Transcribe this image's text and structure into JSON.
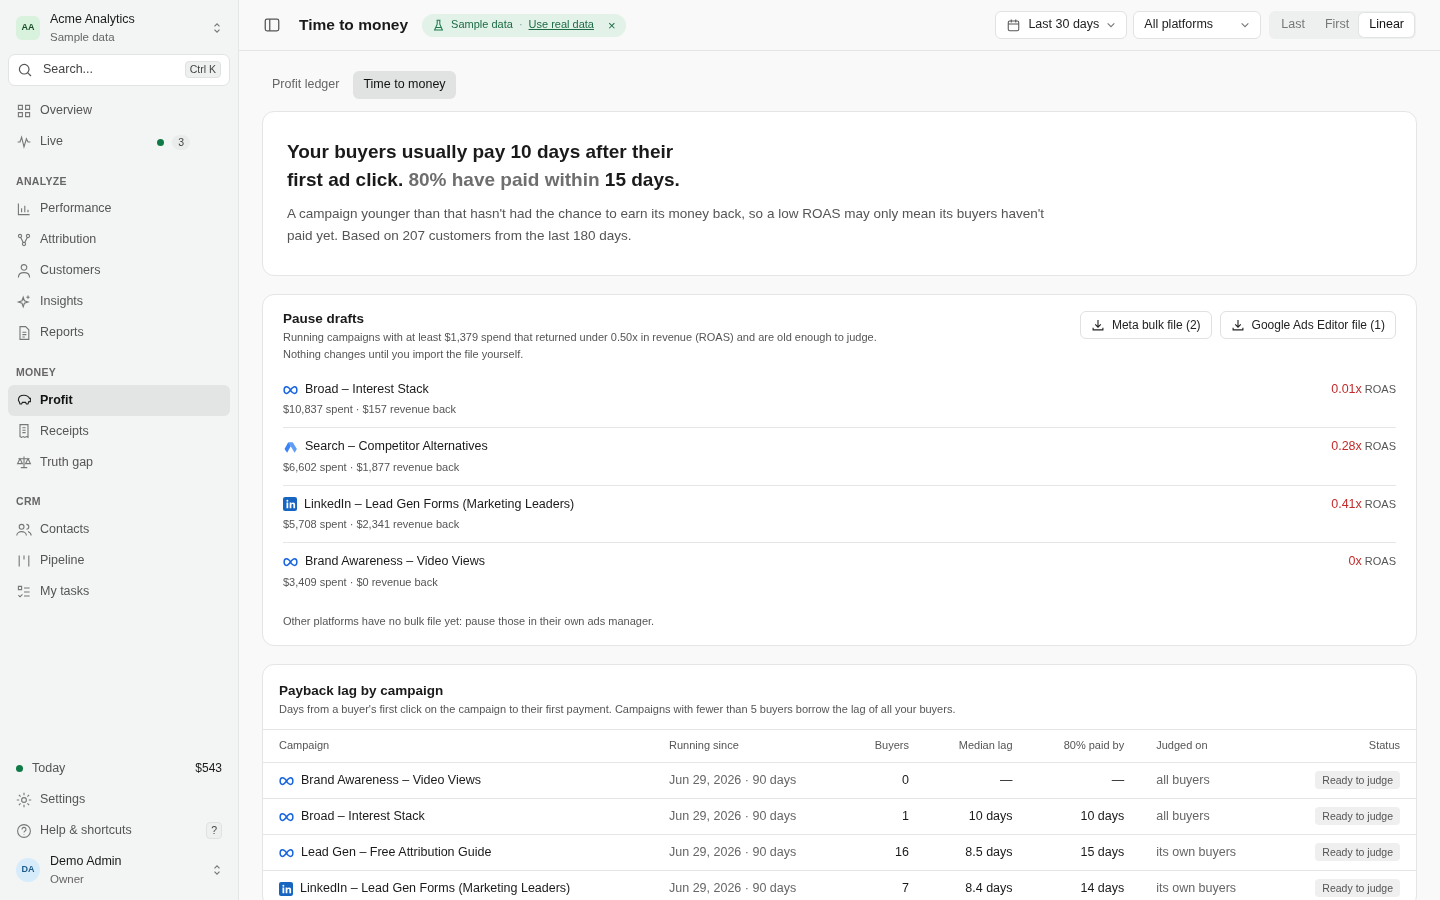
{
  "workspace": {
    "avatar": "AA",
    "name": "Acme Analytics",
    "subtitle": "Sample data"
  },
  "search": {
    "placeholder": "Search...",
    "shortcut": "Ctrl K"
  },
  "nav_top": [
    {
      "label": "Overview",
      "selected": false
    },
    {
      "label": "Live",
      "selected": false,
      "badge": "3"
    }
  ],
  "nav_sections": [
    {
      "title": "ANALYZE",
      "items": [
        {
          "label": "Performance",
          "selected": false
        },
        {
          "label": "Attribution",
          "selected": false
        },
        {
          "label": "Customers",
          "selected": false
        },
        {
          "label": "Insights",
          "selected": false
        },
        {
          "label": "Reports",
          "selected": false
        }
      ]
    },
    {
      "title": "MONEY",
      "items": [
        {
          "label": "Profit",
          "selected": true
        },
        {
          "label": "Receipts",
          "selected": false
        },
        {
          "label": "Truth gap",
          "selected": false
        }
      ]
    },
    {
      "title": "CRM",
      "items": [
        {
          "label": "Contacts",
          "selected": false
        },
        {
          "label": "Pipeline",
          "selected": false
        },
        {
          "label": "My tasks",
          "selected": false
        }
      ]
    }
  ],
  "today": {
    "label": "Today",
    "value": "$543"
  },
  "footer_links": [
    {
      "label": "Settings"
    },
    {
      "label": "Help & shortcuts",
      "shortcut": "?"
    }
  ],
  "user": {
    "avatar": "DA",
    "name": "Demo Admin",
    "role": "Owner"
  },
  "header": {
    "title": "Time to money",
    "banner": {
      "label": "Sample data",
      "separator": "·",
      "link": "Use real data",
      "close": "×"
    },
    "date_range": "Last 30 days",
    "platform": "All platforms",
    "models": [
      {
        "label": "Last",
        "selected": false
      },
      {
        "label": "First",
        "selected": false
      },
      {
        "label": "Linear",
        "selected": true
      }
    ]
  },
  "tabs": [
    {
      "label": "Profit ledger",
      "selected": false
    },
    {
      "label": "Time to money",
      "selected": true
    }
  ],
  "summary": {
    "headline": [
      [
        {
          "text": "Your buyers usually pay 10 days after their",
          "muted": false
        }
      ],
      [
        {
          "text": "first ad click.",
          "muted": false
        },
        {
          "text": "80% have paid within",
          "muted": true
        },
        {
          "text": "15 days.",
          "muted": false
        }
      ]
    ],
    "body": "A campaign younger than that hasn't had the chance to earn its money back, so a low ROAS may only mean its buyers haven't paid yet. Based on 207 customers from the last 180 days."
  },
  "pause_drafts": {
    "title": "Pause drafts",
    "description": "Running campaigns with at least $1,379 spend that returned under 0.50x in revenue (ROAS) and are old enough to judge.",
    "note": "Nothing changes until you import the file yourself.",
    "buttons": [
      "Meta bulk file (2)",
      "Google Ads Editor file (1)"
    ],
    "items": [
      {
        "kind": "meta",
        "name": "Broad – Interest Stack",
        "detail": "$10,837 spent · $157 revenue back",
        "roas": "0.01x",
        "roas_unit": "ROAS"
      },
      {
        "kind": "google",
        "name": "Search – Competitor Alternatives",
        "detail": "$6,602 spent · $1,877 revenue back",
        "roas": "0.28x",
        "roas_unit": "ROAS"
      },
      {
        "kind": "linkedin",
        "name": "LinkedIn – Lead Gen Forms (Marketing Leaders)",
        "detail": "$5,708 spent · $2,341 revenue back",
        "roas": "0.41x",
        "roas_unit": "ROAS"
      },
      {
        "kind": "meta",
        "name": "Brand Awareness – Video Views",
        "detail": "$3,409 spent · $0 revenue back",
        "roas": "0x",
        "roas_unit": "ROAS"
      }
    ],
    "footer": "Other platforms have no bulk file yet: pause those in their own ads manager."
  },
  "payback": {
    "title": "Payback lag by campaign",
    "description": "Days from a buyer's first click on the campaign to their first payment. Campaigns with fewer than 5 buyers borrow the lag of all your buyers.",
    "columns": [
      "Campaign",
      "Running since",
      "Buyers",
      "Median lag",
      "80% paid by",
      "Judged on",
      "Status"
    ],
    "rows": [
      {
        "kind": "meta",
        "campaign": "Brand Awareness – Video Views",
        "running_since": "Jun 29, 2026 · 90 days",
        "buyers": "0",
        "median_lag": "—",
        "paid_80": "—",
        "judged_on": "all buyers",
        "status": "Ready to judge"
      },
      {
        "kind": "meta",
        "campaign": "Broad – Interest Stack",
        "running_since": "Jun 29, 2026 · 90 days",
        "buyers": "1",
        "median_lag": "10 days",
        "paid_80": "10 days",
        "judged_on": "all buyers",
        "status": "Ready to judge"
      },
      {
        "kind": "meta",
        "campaign": "Lead Gen – Free Attribution Guide",
        "running_since": "Jun 29, 2026 · 90 days",
        "buyers": "16",
        "median_lag": "8.5 days",
        "paid_80": "15 days",
        "judged_on": "its own buyers",
        "status": "Ready to judge"
      },
      {
        "kind": "linkedin",
        "campaign": "LinkedIn – Lead Gen Forms (Marketing Leaders)",
        "running_since": "Jun 29, 2026 · 90 days",
        "buyers": "7",
        "median_lag": "8.4 days",
        "paid_80": "14 days",
        "judged_on": "its own buyers",
        "status": "Ready to judge"
      }
    ]
  }
}
